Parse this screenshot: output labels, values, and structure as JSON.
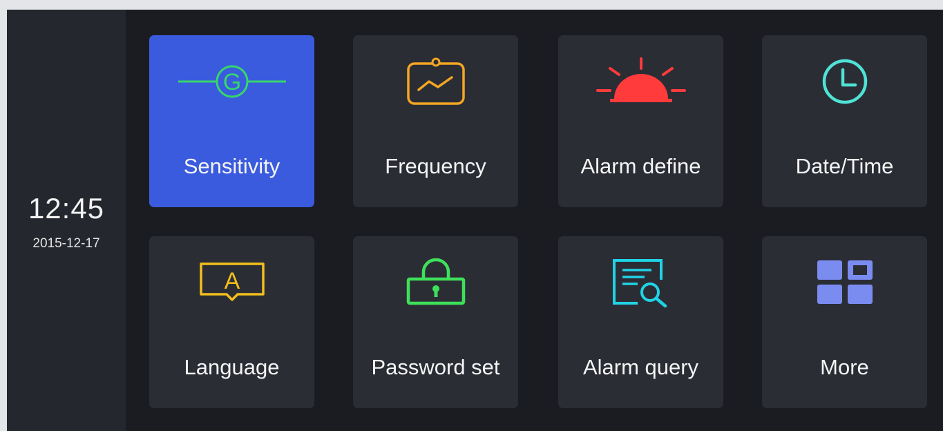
{
  "clock": {
    "time": "12:45",
    "date": "2015-12-17"
  },
  "menu": {
    "tiles": [
      {
        "label": "Sensitivity",
        "icon": "g-sensor-icon",
        "active": true,
        "icon_color": "#36d66c"
      },
      {
        "label": "Frequency",
        "icon": "frequency-chart-icon",
        "active": false,
        "icon_color": "#f4a623"
      },
      {
        "label": "Alarm define",
        "icon": "alarm-light-icon",
        "active": false,
        "icon_color": "#ff3b3b"
      },
      {
        "label": "Date/Time",
        "icon": "clock-icon",
        "active": false,
        "icon_color": "#4fe3d6"
      },
      {
        "label": "Language",
        "icon": "language-icon",
        "active": false,
        "icon_color": "#f2c01c"
      },
      {
        "label": "Password set",
        "icon": "lock-icon",
        "active": false,
        "icon_color": "#3ee05a"
      },
      {
        "label": "Alarm query",
        "icon": "search-document-icon",
        "active": false,
        "icon_color": "#21d3e6"
      },
      {
        "label": "More",
        "icon": "more-grid-icon",
        "active": false,
        "icon_color": "#7b8cf0"
      }
    ]
  },
  "colors": {
    "screen_bg": "#1a1c22",
    "sidebar_bg": "#25272e",
    "tile_bg": "#2b2d35",
    "active_tile_bg": "#3a5bde"
  }
}
